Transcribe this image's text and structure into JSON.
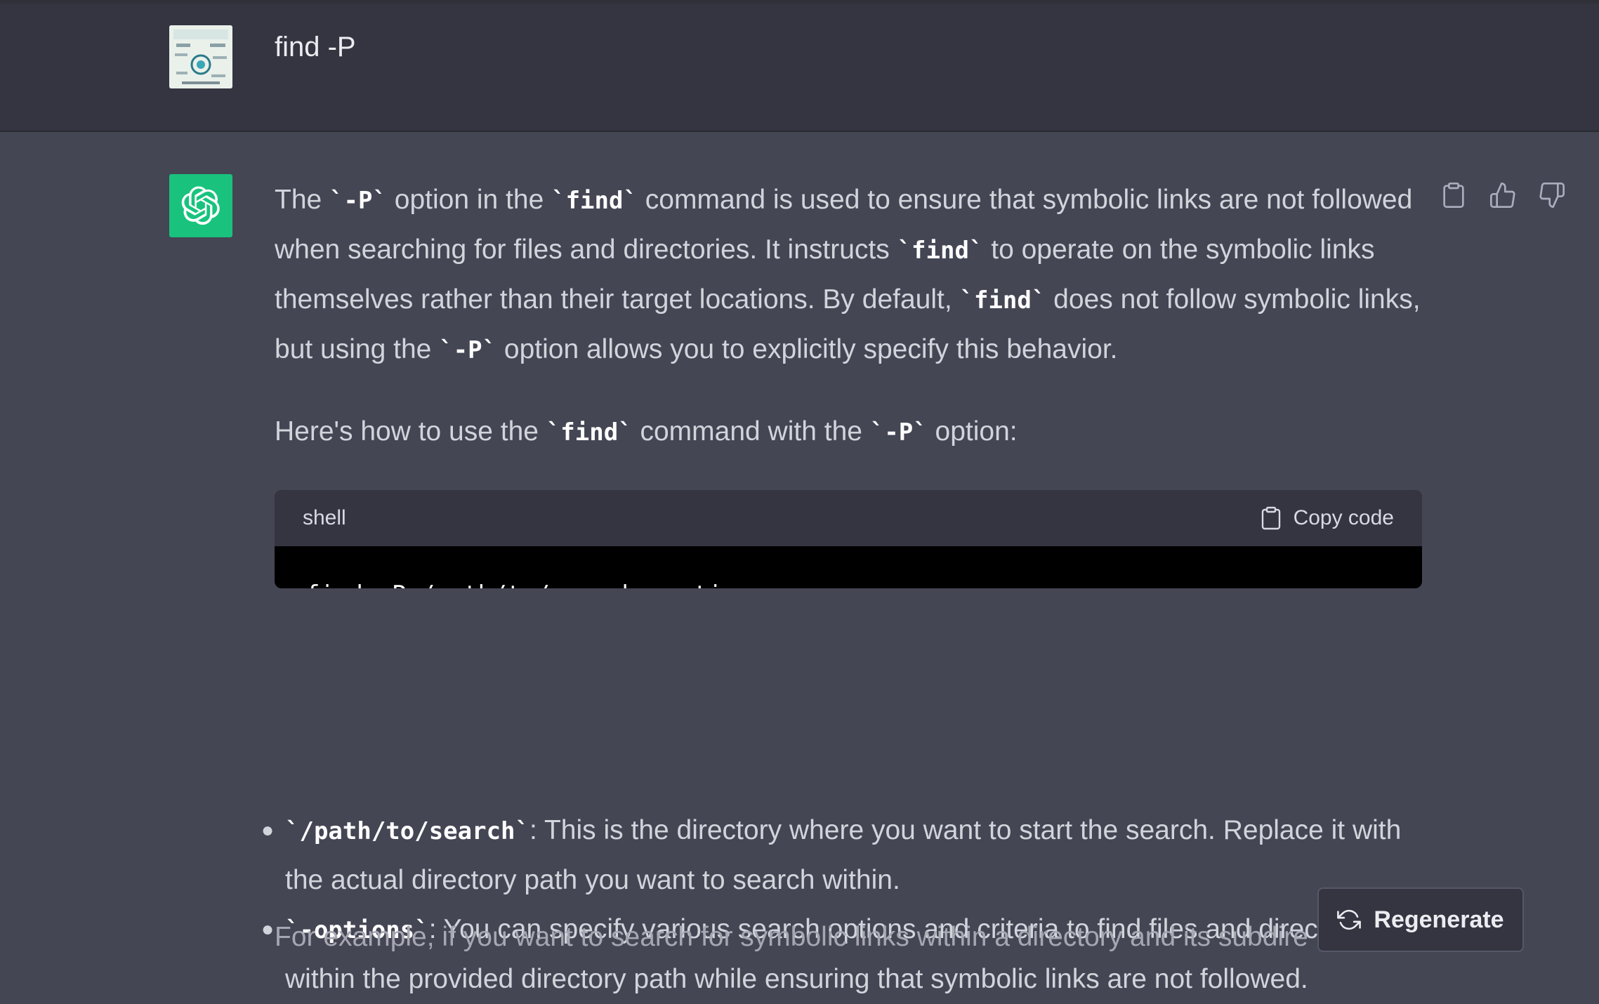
{
  "user_message": {
    "text": "find -P"
  },
  "assistant": {
    "p1": {
      "t1": "The ",
      "c1": "`-P`",
      "t2": " option in the ",
      "c2": "`find`",
      "t3": " command is used to ensure that symbolic links are not followed when searching for files and directories. It instructs ",
      "c3": "`find`",
      "t4": " to operate on the symbolic links themselves rather than their target locations. By default, ",
      "c4": "`find`",
      "t5": " does not follow symbolic links, but using the ",
      "c5": "`-P`",
      "t6": " option allows you to explicitly specify this behavior."
    },
    "p2": {
      "t1": "Here's how to use the ",
      "c1": "`find`",
      "t2": " command with the ",
      "c2": "`-P`",
      "t3": " option:"
    },
    "code_block": {
      "language": "shell",
      "copy_label": "Copy code",
      "code": "find -P /path/to/search -options"
    },
    "bullets": [
      {
        "code": "`/path/to/search`",
        "text": ": This is the directory where you want to start the search. Replace it with the actual directory path you want to search within."
      },
      {
        "code": "`-options`",
        "text": ": You can specify various search options and criteria to find files and directories within the provided directory path while ensuring that symbolic links are not followed."
      }
    ],
    "faded_line": "For example, if you want to search for symbolic links within a directory and its subdire"
  },
  "actions": {
    "copy_icon": "clipboard-icon",
    "like_icon": "thumbs-up-icon",
    "dislike_icon": "thumbs-down-icon"
  },
  "regenerate": {
    "label": "Regenerate",
    "icon": "refresh-icon"
  },
  "colors": {
    "page_bg": "#444654",
    "user_row_bg": "#343541",
    "accent": "#19c37d",
    "code_bg": "#000000",
    "code_header_bg": "#343541"
  }
}
